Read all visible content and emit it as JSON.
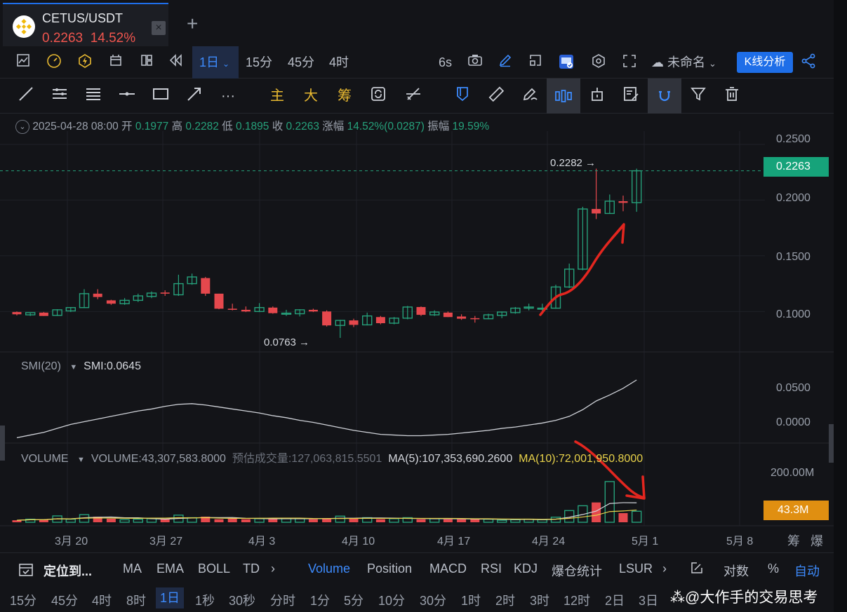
{
  "tab": {
    "pair": "CETUS/USDT",
    "price": "0.2263",
    "change": "14.52%",
    "close": "×",
    "add": "+"
  },
  "toolbar": {
    "interval": "1日",
    "tf_15m": "15分",
    "tf_45m": "45分",
    "tf_4h": "4时",
    "refresh": "6s",
    "layout_name": "未命名",
    "k_analysis": "K线分析"
  },
  "drawing": {
    "main": "主",
    "big": "大",
    "chip": "筹",
    "more": "···"
  },
  "ohlc": {
    "date": "2025-04-28 08:00",
    "open_label": "开",
    "open": "0.1977",
    "high_label": "高",
    "high": "0.2282",
    "low_label": "低",
    "low": "0.1895",
    "close_label": "收",
    "close": "0.2263",
    "change_label": "涨幅",
    "change": "14.52%(0.0287)",
    "amp_label": "振幅",
    "amp": "19.59%"
  },
  "price_axis": [
    "0.2500",
    "0.2000",
    "0.1500",
    "0.1000"
  ],
  "current_price": "0.2263",
  "high_marker": "0.2282 →",
  "low_marker": "0.0763 →",
  "smi": {
    "label": "SMI(20)",
    "value": "SMI:0.0645",
    "axis": [
      "0.0500",
      "0.0000"
    ]
  },
  "volume": {
    "label": "VOLUME",
    "value": "VOLUME:43,307,583.8000",
    "estimate": "预估成交量:127,063,815.5501",
    "ma5": "MA(5):107,353,690.2600",
    "ma10": "MA(10):72,001,950.8000",
    "axis_top": "200.00M",
    "current": "43.3M"
  },
  "x_axis": [
    "3月 20",
    "3月 27",
    "4月 3",
    "4月 10",
    "4月 17",
    "4月 24",
    "5月 1",
    "5月 8"
  ],
  "x_axis_right": [
    "筹",
    "爆"
  ],
  "bottom_tabs": {
    "locate": "定位到...",
    "ma": "MA",
    "ema": "EMA",
    "boll": "BOLL",
    "td": "TD",
    "volume": "Volume",
    "position": "Position",
    "macd": "MACD",
    "rsi": "RSI",
    "kdj": "KDJ",
    "liq": "爆仓统计",
    "lsur": "LSUR",
    "log": "对数",
    "pct": "%",
    "auto": "自动"
  },
  "timeframes": [
    "15分",
    "45分",
    "4时",
    "8时",
    "1日",
    "1秒",
    "30秒",
    "分时",
    "1分",
    "5分",
    "10分",
    "30分",
    "1时",
    "2时",
    "3时",
    "12时",
    "2日",
    "3日"
  ],
  "watermark": "@大作手的交易思考",
  "colors": {
    "up": "#26a17b",
    "down": "#e5484d",
    "accent": "#1e6ee8"
  },
  "chart_data": {
    "type": "candlestick",
    "candles": [
      {
        "o": 0.0995,
        "h": 0.1,
        "l": 0.0965,
        "c": 0.0975
      },
      {
        "o": 0.097,
        "h": 0.0985,
        "l": 0.096,
        "c": 0.099
      },
      {
        "o": 0.099,
        "h": 0.0995,
        "l": 0.096,
        "c": 0.096
      },
      {
        "o": 0.0965,
        "h": 0.102,
        "l": 0.096,
        "c": 0.1015
      },
      {
        "o": 0.1005,
        "h": 0.104,
        "l": 0.0995,
        "c": 0.1035
      },
      {
        "o": 0.1035,
        "h": 0.12,
        "l": 0.103,
        "c": 0.116
      },
      {
        "o": 0.116,
        "h": 0.12,
        "l": 0.111,
        "c": 0.113
      },
      {
        "o": 0.11,
        "h": 0.1105,
        "l": 0.106,
        "c": 0.107
      },
      {
        "o": 0.107,
        "h": 0.112,
        "l": 0.106,
        "c": 0.11
      },
      {
        "o": 0.11,
        "h": 0.116,
        "l": 0.1085,
        "c": 0.114
      },
      {
        "o": 0.1135,
        "h": 0.118,
        "l": 0.112,
        "c": 0.1165
      },
      {
        "o": 0.117,
        "h": 0.119,
        "l": 0.114,
        "c": 0.116
      },
      {
        "o": 0.115,
        "h": 0.133,
        "l": 0.114,
        "c": 0.125
      },
      {
        "o": 0.125,
        "h": 0.134,
        "l": 0.124,
        "c": 0.131
      },
      {
        "o": 0.13,
        "h": 0.131,
        "l": 0.114,
        "c": 0.116
      },
      {
        "o": 0.116,
        "h": 0.116,
        "l": 0.102,
        "c": 0.1025
      },
      {
        "o": 0.1025,
        "h": 0.107,
        "l": 0.101,
        "c": 0.1015
      },
      {
        "o": 0.1015,
        "h": 0.1045,
        "l": 0.0995,
        "c": 0.1
      },
      {
        "o": 0.1,
        "h": 0.1075,
        "l": 0.0995,
        "c": 0.1035
      },
      {
        "o": 0.1035,
        "h": 0.1045,
        "l": 0.098,
        "c": 0.0985
      },
      {
        "o": 0.0985,
        "h": 0.1015,
        "l": 0.096,
        "c": 0.0985
      },
      {
        "o": 0.098,
        "h": 0.102,
        "l": 0.0955,
        "c": 0.1015
      },
      {
        "o": 0.1015,
        "h": 0.1025,
        "l": 0.0995,
        "c": 0.1
      },
      {
        "o": 0.1,
        "h": 0.101,
        "l": 0.0865,
        "c": 0.0875
      },
      {
        "o": 0.0875,
        "h": 0.0925,
        "l": 0.0763,
        "c": 0.092
      },
      {
        "o": 0.092,
        "h": 0.0935,
        "l": 0.086,
        "c": 0.088
      },
      {
        "o": 0.088,
        "h": 0.099,
        "l": 0.0875,
        "c": 0.096
      },
      {
        "o": 0.095,
        "h": 0.096,
        "l": 0.0885,
        "c": 0.0895
      },
      {
        "o": 0.0895,
        "h": 0.095,
        "l": 0.0885,
        "c": 0.094
      },
      {
        "o": 0.094,
        "h": 0.105,
        "l": 0.093,
        "c": 0.104
      },
      {
        "o": 0.104,
        "h": 0.1045,
        "l": 0.096,
        "c": 0.097
      },
      {
        "o": 0.097,
        "h": 0.101,
        "l": 0.096,
        "c": 0.0995
      },
      {
        "o": 0.099,
        "h": 0.1,
        "l": 0.095,
        "c": 0.095
      },
      {
        "o": 0.0955,
        "h": 0.0975,
        "l": 0.0925,
        "c": 0.0935
      },
      {
        "o": 0.094,
        "h": 0.096,
        "l": 0.09,
        "c": 0.0935
      },
      {
        "o": 0.0935,
        "h": 0.098,
        "l": 0.093,
        "c": 0.097
      },
      {
        "o": 0.0965,
        "h": 0.1,
        "l": 0.094,
        "c": 0.0995
      },
      {
        "o": 0.099,
        "h": 0.104,
        "l": 0.098,
        "c": 0.103
      },
      {
        "o": 0.103,
        "h": 0.107,
        "l": 0.101,
        "c": 0.104
      },
      {
        "o": 0.103,
        "h": 0.107,
        "l": 0.1,
        "c": 0.103
      },
      {
        "o": 0.103,
        "h": 0.124,
        "l": 0.1025,
        "c": 0.122
      },
      {
        "o": 0.122,
        "h": 0.143,
        "l": 0.121,
        "c": 0.138
      },
      {
        "o": 0.138,
        "h": 0.194,
        "l": 0.137,
        "c": 0.192
      },
      {
        "o": 0.192,
        "h": 0.2282,
        "l": 0.183,
        "c": 0.188
      },
      {
        "o": 0.188,
        "h": 0.205,
        "l": 0.188,
        "c": 0.199
      },
      {
        "o": 0.199,
        "h": 0.204,
        "l": 0.19,
        "c": 0.1975
      },
      {
        "o": 0.1977,
        "h": 0.2282,
        "l": 0.1895,
        "c": 0.2263
      }
    ],
    "volume_M": [
      8,
      12,
      10,
      25,
      12,
      30,
      22,
      14,
      10,
      12,
      14,
      12,
      28,
      18,
      22,
      12,
      14,
      12,
      14,
      16,
      14,
      14,
      12,
      16,
      24,
      14,
      18,
      12,
      14,
      18,
      12,
      14,
      12,
      12,
      14,
      12,
      8,
      10,
      12,
      10,
      20,
      46,
      65,
      78,
      160,
      36,
      43.3
    ],
    "smi": [
      -0.022,
      -0.018,
      -0.014,
      -0.008,
      -0.002,
      0.002,
      0.006,
      0.01,
      0.014,
      0.018,
      0.021,
      0.025,
      0.028,
      0.029,
      0.027,
      0.024,
      0.021,
      0.018,
      0.015,
      0.011,
      0.008,
      0.004,
      0.001,
      -0.003,
      -0.007,
      -0.011,
      -0.014,
      -0.017,
      -0.018,
      -0.019,
      -0.019,
      -0.018,
      -0.017,
      -0.015,
      -0.013,
      -0.011,
      -0.008,
      -0.006,
      -0.003,
      0.0,
      0.004,
      0.01,
      0.02,
      0.033,
      0.042,
      0.052,
      0.0645
    ],
    "ylim": [
      0.07,
      0.255
    ],
    "smi_lim": [
      -0.03,
      0.075
    ],
    "vol_lim": [
      0,
      215
    ]
  }
}
